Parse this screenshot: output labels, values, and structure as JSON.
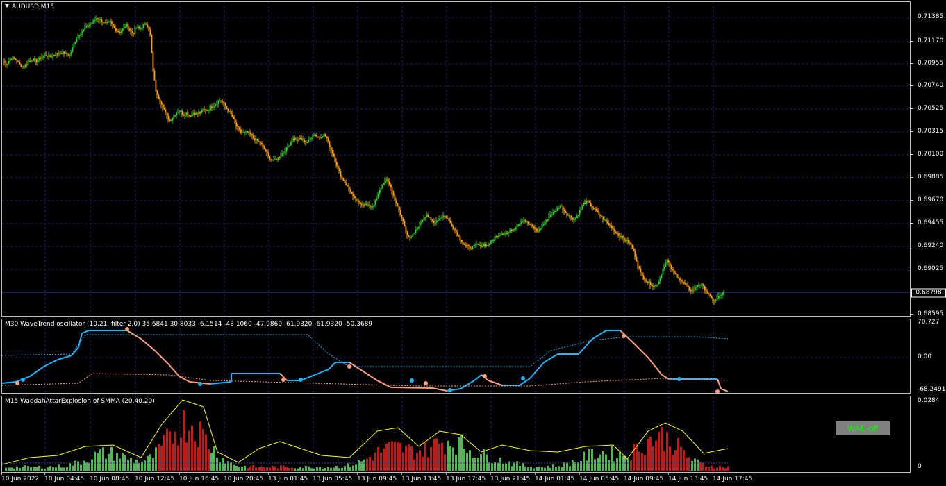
{
  "symbol_title": "AUDUSD,M15",
  "current_price": "0.68798",
  "colors": {
    "background": "#000000",
    "bull_candle": "#32CD32",
    "bear_candle": "#FFA500",
    "grid": "#1e1e6e",
    "wavetrend_up": "#1eb4ff",
    "wavetrend_down": "#ffa07a",
    "wae_green": "#32CD32",
    "wae_red": "#FF0000",
    "wae_line": "#FFFF00"
  },
  "price_axis": [
    "0.71385",
    "0.71170",
    "0.70955",
    "0.70740",
    "0.70525",
    "0.70315",
    "0.70100",
    "0.69885",
    "0.69670",
    "0.69455",
    "0.69240",
    "0.69025",
    "0.68595"
  ],
  "time_axis": [
    "10 Jun 2022",
    "10 Jun 04:45",
    "10 Jun 08:45",
    "10 Jun 12:45",
    "10 Jun 16:45",
    "10 Jun 20:45",
    "13 Jun 01:45",
    "13 Jun 05:45",
    "13 Jun 09:45",
    "13 Jun 13:45",
    "13 Jun 17:45",
    "13 Jun 21:45",
    "14 Jun 01:45",
    "14 Jun 05:45",
    "14 Jun 09:45",
    "14 Jun 13:45",
    "14 Jun 17:45"
  ],
  "oscillator": {
    "title": "M30 WaveTrend oscillator (10,21, filter 2.0) 35.6841 30.8033 -6.1514 -43.1060 -47.9869 -61.9320 -61.9320 -50.3689",
    "levels": [
      "70.727",
      "0.00",
      "-68.2491"
    ]
  },
  "wae": {
    "title": "M15 WaddahAttarExplosion of SMMA (20,40,20)",
    "levels": [
      "0.0284",
      "0"
    ],
    "button_label": "WAE-off"
  },
  "chart_data": {
    "type": "candlestick",
    "title": "AUDUSD,M15",
    "interval": "M15",
    "ylim": [
      0.68595,
      0.71385
    ],
    "path_close": [
      0.7096,
      0.7093,
      0.7098,
      0.7099,
      0.7097,
      0.7093,
      0.7091,
      0.7094,
      0.7097,
      0.7098,
      0.7096,
      0.7099,
      0.7101,
      0.7102,
      0.71,
      0.7102,
      0.7103,
      0.7104,
      0.7104,
      0.7103,
      0.7102,
      0.711,
      0.7118,
      0.7122,
      0.7125,
      0.7128,
      0.7131,
      0.7133,
      0.7137,
      0.7135,
      0.7133,
      0.7131,
      0.7133,
      0.7128,
      0.7125,
      0.7123,
      0.7127,
      0.713,
      0.7125,
      0.7122,
      0.7128,
      0.7126,
      0.713,
      0.7131,
      0.7125,
      0.7085,
      0.7065,
      0.706,
      0.7053,
      0.7045,
      0.704,
      0.7045,
      0.7048,
      0.705,
      0.7046,
      0.7048,
      0.7045,
      0.7048,
      0.7047,
      0.7048,
      0.7051,
      0.705,
      0.7053,
      0.7055,
      0.7057,
      0.706,
      0.7057,
      0.7052,
      0.7048,
      0.7042,
      0.7035,
      0.703,
      0.7029,
      0.703,
      0.7028,
      0.7024,
      0.7022,
      0.702,
      0.7015,
      0.701,
      0.7005,
      0.7003,
      0.7005,
      0.7008,
      0.7011,
      0.7015,
      0.702,
      0.7024,
      0.7022,
      0.7024,
      0.7022,
      0.702,
      0.7024,
      0.7028,
      0.7026,
      0.7025,
      0.7028,
      0.7024,
      0.7015,
      0.7008,
      0.6998,
      0.699,
      0.6985,
      0.698,
      0.6975,
      0.6968,
      0.6965,
      0.6963,
      0.6963,
      0.6962,
      0.696,
      0.6962,
      0.6968,
      0.6977,
      0.6983,
      0.6985,
      0.698,
      0.697,
      0.6962,
      0.6953,
      0.6945,
      0.6935,
      0.693,
      0.6935,
      0.694,
      0.6945,
      0.695,
      0.6953,
      0.6948,
      0.6945,
      0.6948,
      0.695,
      0.6952,
      0.695,
      0.6945,
      0.694,
      0.6935,
      0.693,
      0.6925,
      0.6923,
      0.6922,
      0.6923,
      0.6925,
      0.6923,
      0.6925,
      0.6924,
      0.6927,
      0.693,
      0.6933,
      0.6935,
      0.6936,
      0.6935,
      0.6938,
      0.694,
      0.6943,
      0.6946,
      0.6948,
      0.6945,
      0.6943,
      0.694,
      0.6937,
      0.694,
      0.6945,
      0.6948,
      0.6953,
      0.6955,
      0.6958,
      0.6962,
      0.6957,
      0.6953,
      0.6951,
      0.6948,
      0.6952,
      0.6958,
      0.6963,
      0.6965,
      0.6962,
      0.6958,
      0.6955,
      0.6952,
      0.6948,
      0.6945,
      0.6942,
      0.6938,
      0.6935,
      0.6932,
      0.693,
      0.6928,
      0.6925,
      0.6918,
      0.6908,
      0.6898,
      0.6893,
      0.689,
      0.6888,
      0.6886,
      0.6888,
      0.6895,
      0.6905,
      0.691,
      0.6903,
      0.6898,
      0.6895,
      0.6891,
      0.6888,
      0.6885,
      0.6882,
      0.6883,
      0.6887,
      0.6888,
      0.6884,
      0.688,
      0.6875,
      0.6872,
      0.6875,
      0.6878,
      0.688
    ]
  }
}
